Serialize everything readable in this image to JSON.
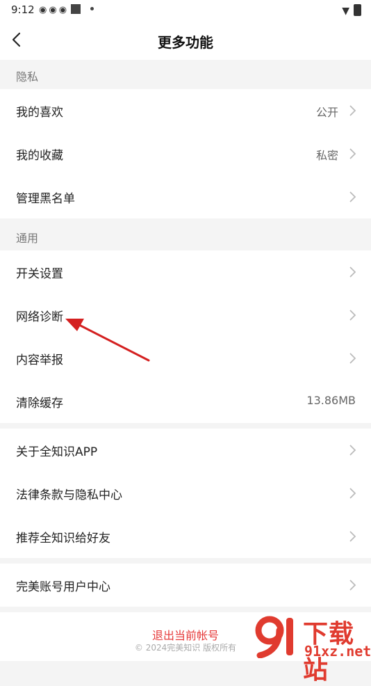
{
  "status_bar": {
    "time": "9:12",
    "notif_icons": [
      "weibo-icon",
      "weibo-icon",
      "weibo-icon",
      "app-square-icon",
      "dot-icon"
    ],
    "right_icons": [
      "wifi-icon",
      "battery-icon"
    ]
  },
  "nav": {
    "title": "更多功能",
    "back_icon": "chevron-left-icon"
  },
  "sections": {
    "privacy": {
      "header": "隐私",
      "items": [
        {
          "label": "我的喜欢",
          "value": "公开"
        },
        {
          "label": "我的收藏",
          "value": "私密"
        },
        {
          "label": "管理黑名单",
          "value": ""
        }
      ]
    },
    "general": {
      "header": "通用",
      "items": [
        {
          "label": "开关设置",
          "value": ""
        },
        {
          "label": "网络诊断",
          "value": ""
        },
        {
          "label": "内容举报",
          "value": ""
        },
        {
          "label": "清除缓存",
          "value": "13.86MB"
        }
      ]
    },
    "about": {
      "items": [
        {
          "label": "关于全知识APP"
        },
        {
          "label": "法律条款与隐私中心"
        },
        {
          "label": "推荐全知识给好友"
        }
      ]
    },
    "account": {
      "items": [
        {
          "label": "完美账号用户中心"
        }
      ]
    }
  },
  "footer": {
    "logout": "退出当前帐号",
    "copyright": "© 2024完美知识 版权所有"
  },
  "watermark": {
    "brand": "下载站",
    "site": "91xz.net"
  },
  "colors": {
    "accent_red": "#e63a3a",
    "background": "#f4f4f4",
    "annotation_arrow": "#d42020"
  }
}
